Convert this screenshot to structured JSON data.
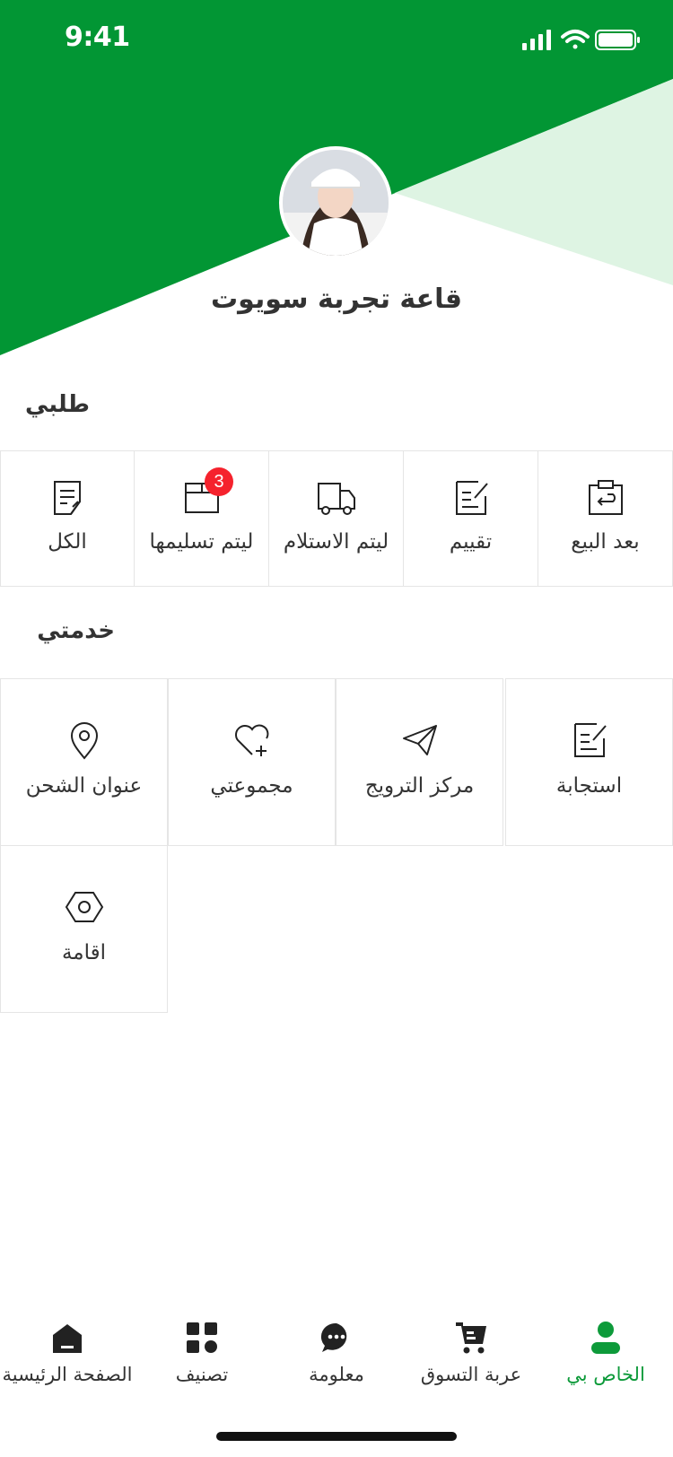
{
  "status_bar": {
    "time": "9:41"
  },
  "profile": {
    "username": "قاعة تجربة سويوت"
  },
  "orders": {
    "title": "طلبي",
    "items": [
      {
        "label": "بعد البيع",
        "icon": "after-sale-icon"
      },
      {
        "label": "تقييم",
        "icon": "review-icon"
      },
      {
        "label": "ليتم الاستلام",
        "icon": "truck-icon"
      },
      {
        "label": "ليتم تسليمها",
        "icon": "box-icon",
        "badge": "3"
      },
      {
        "label": "الكل",
        "icon": "all-orders-icon"
      }
    ]
  },
  "services": {
    "title": "خدمتي",
    "items": [
      {
        "label": "استجابة",
        "icon": "feedback-icon"
      },
      {
        "label": "مركز الترويج",
        "icon": "paper-plane-icon"
      },
      {
        "label": "مجموعتي",
        "icon": "heart-plus-icon"
      },
      {
        "label": "عنوان الشحن",
        "icon": "location-pin-icon"
      },
      {
        "label": "اقامة",
        "icon": "settings-hexagon-icon"
      }
    ]
  },
  "tabbar": {
    "items": [
      {
        "label": "الخاص بي",
        "icon": "user-icon",
        "active": true
      },
      {
        "label": "عربة التسوق",
        "icon": "cart-icon"
      },
      {
        "label": "معلومة",
        "icon": "chat-icon"
      },
      {
        "label": "تصنيف",
        "icon": "category-icon"
      },
      {
        "label": "الصفحة الرئيسية",
        "icon": "home-icon"
      }
    ]
  },
  "colors": {
    "primary": "#0d9a3a",
    "header_green": "#029634",
    "header_light": "#def4e3",
    "badge": "#f5222d"
  }
}
